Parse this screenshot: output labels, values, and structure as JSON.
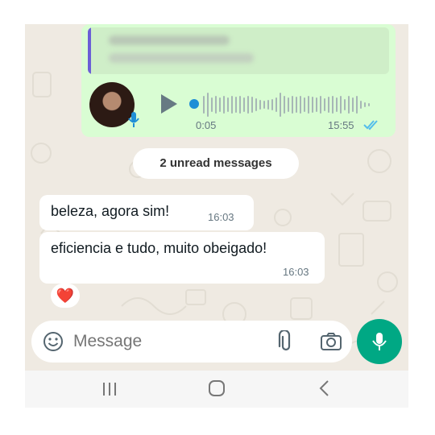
{
  "voice_message": {
    "duration": "0:05",
    "time": "15:55",
    "status_icon": "double-check-icon"
  },
  "unread_divider": "2 unread messages",
  "messages": [
    {
      "text": "beleza, agora sim!",
      "time": "16:03"
    },
    {
      "text": "eficiencia e tudo, muito obeigado!",
      "time": "16:03"
    }
  ],
  "reaction": "❤️",
  "composer": {
    "placeholder": "Message",
    "icons": [
      "emoji-icon",
      "attachment-icon",
      "camera-icon",
      "microphone-icon"
    ]
  },
  "colors": {
    "chat_background": "#efeae2",
    "outgoing_bubble": "#d9fdd3",
    "accent": "#00a884",
    "read_ticks": "#53bdeb"
  }
}
